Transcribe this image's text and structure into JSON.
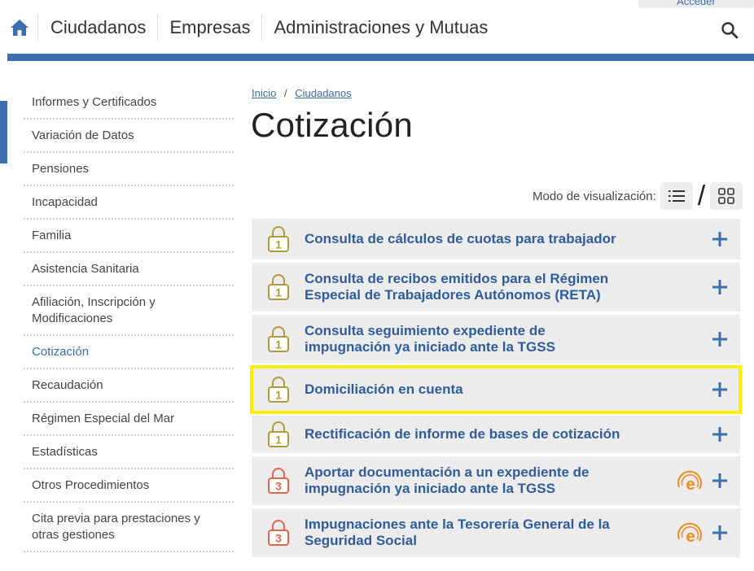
{
  "header": {
    "acceder_label": "Acceder",
    "nav": [
      "Ciudadanos",
      "Empresas",
      "Administraciones y Mutuas"
    ],
    "accent_color": "#3d6fb0"
  },
  "sidebar": {
    "items": [
      {
        "label": "Informes y Certificados",
        "active": false
      },
      {
        "label": "Variación de Datos",
        "active": false
      },
      {
        "label": "Pensiones",
        "active": false
      },
      {
        "label": "Incapacidad",
        "active": false
      },
      {
        "label": "Familia",
        "active": false
      },
      {
        "label": "Asistencia Sanitaria",
        "active": false
      },
      {
        "label": "Afiliación, Inscripción y Modificaciones",
        "active": false
      },
      {
        "label": "Cotización",
        "active": true
      },
      {
        "label": "Recaudación",
        "active": false
      },
      {
        "label": "Régimen Especial del Mar",
        "active": false
      },
      {
        "label": "Estadísticas",
        "active": false
      },
      {
        "label": "Otros Procedimientos",
        "active": false
      },
      {
        "label": "Cita previa para prestaciones y otras gestiones",
        "active": false
      }
    ]
  },
  "breadcrumb": {
    "home": "Inicio",
    "separator": "/",
    "current": "Ciudadanos"
  },
  "page_title": "Cotización",
  "view_mode": {
    "label": "Modo de visualización:",
    "slash": "/"
  },
  "procedures": [
    {
      "title": "Consulta de cálculos de cuotas para trabajador",
      "level": "1",
      "registro": false,
      "highlight": false
    },
    {
      "title": "Consulta de recibos emitidos para el Régimen Especial de Trabajadores Autónomos (RETA)",
      "level": "1",
      "registro": false,
      "highlight": false
    },
    {
      "title": "Consulta seguimiento expediente de impugnación ya iniciado ante la TGSS",
      "level": "1",
      "registro": false,
      "highlight": false
    },
    {
      "title": "Domiciliación en cuenta",
      "level": "1",
      "registro": false,
      "highlight": true
    },
    {
      "title": "Rectificación de informe de bases de cotización",
      "level": "1",
      "registro": false,
      "highlight": false
    },
    {
      "title": "Aportar documentación a un expediente de impugnación ya iniciado ante la TGSS",
      "level": "3",
      "registro": true,
      "highlight": false
    },
    {
      "title": "Impugnaciones ante la Tesorería General de la Seguridad Social",
      "level": "3",
      "registro": true,
      "highlight": false
    }
  ],
  "colors": {
    "level1": "#b09a3a",
    "level3": "#e0654a",
    "registro": "#f08a1c",
    "link": "#2f5d99",
    "highlight": "#ffee00"
  }
}
